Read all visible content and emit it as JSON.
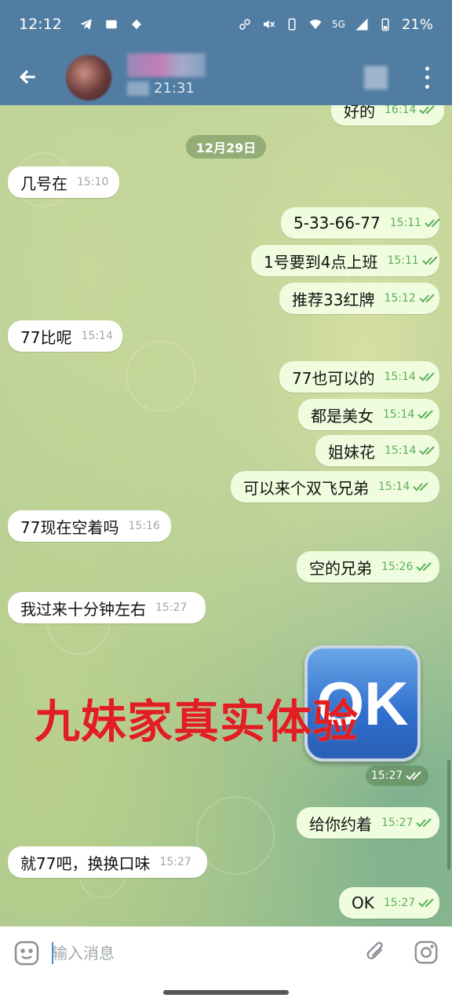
{
  "status_bar": {
    "time": "12:12",
    "left_icons": [
      "telegram-icon",
      "mail-icon",
      "app-icon"
    ],
    "right_icons": [
      "link-icon",
      "mute-icon",
      "vibrate-icon",
      "wifi-icon",
      "5g-icon",
      "signal-icon",
      "battery-icon"
    ],
    "network": "5G",
    "battery": "21%"
  },
  "header": {
    "last_seen_time": "21:31"
  },
  "chat": {
    "top_partial": {
      "text": "好的",
      "time": "16:14"
    },
    "date_chip": "12月29日",
    "messages": [
      {
        "dir": "in",
        "text": "几号在",
        "time": "15:10"
      },
      {
        "dir": "out",
        "text": "5-33-66-77",
        "time": "15:11"
      },
      {
        "dir": "out",
        "text": "1号要到4点上班",
        "time": "15:11"
      },
      {
        "dir": "out",
        "text": "推荐33红牌",
        "time": "15:12"
      },
      {
        "dir": "in",
        "text": "77比呢",
        "time": "15:14"
      },
      {
        "dir": "out",
        "text": "77也可以的",
        "time": "15:14"
      },
      {
        "dir": "out",
        "text": "都是美女",
        "time": "15:14"
      },
      {
        "dir": "out",
        "text": "姐妹花",
        "time": "15:14"
      },
      {
        "dir": "out",
        "text": "可以来个双飞兄弟",
        "time": "15:14"
      },
      {
        "dir": "in",
        "text": "77现在空着吗",
        "time": "15:16"
      },
      {
        "dir": "out",
        "text": "空的兄弟",
        "time": "15:26"
      },
      {
        "dir": "in",
        "text": "我过来十分钟左右",
        "time": "15:27"
      },
      {
        "dir": "out",
        "text": "给你约着",
        "time": "15:27"
      },
      {
        "dir": "in",
        "text": "就77吧，换换口味",
        "time": "15:27"
      },
      {
        "dir": "out",
        "text": "OK",
        "time": "15:27"
      }
    ],
    "sticker": {
      "label": "OK",
      "time": "15:27"
    },
    "overlay_text": "九妹家真实体验"
  },
  "input": {
    "placeholder": "输入消息"
  },
  "colors": {
    "header": "#517da2",
    "outgoing_bubble": "#effdde",
    "incoming_bubble": "#ffffff",
    "overlay_text": "#e11f22",
    "check": "#5dae5a"
  }
}
